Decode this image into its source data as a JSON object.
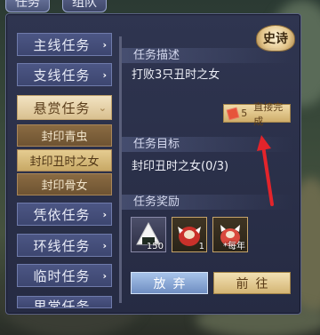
{
  "top_tabs": [
    "任务",
    "组队"
  ],
  "nav": {
    "items": [
      {
        "label": "主线任务",
        "chevron": "›"
      },
      {
        "label": "支线任务",
        "chevron": "›"
      },
      {
        "label": "悬赏任务",
        "chevron": "⌄",
        "active": true
      },
      {
        "label": "凭依任务",
        "chevron": "›"
      },
      {
        "label": "环线任务",
        "chevron": "›"
      },
      {
        "label": "临时任务",
        "chevron": "›"
      },
      {
        "label": "里常任务",
        "chevron": "›"
      }
    ],
    "subitems": [
      {
        "label": "封印青虫",
        "selected": false
      },
      {
        "label": "封印丑时之女",
        "selected": true
      },
      {
        "label": "封印骨女",
        "selected": false
      }
    ]
  },
  "detail": {
    "desc_title": "任务描述",
    "desc_text": "打败3只丑时之女",
    "goal_title": "任务目标",
    "goal_text": "封印丑时之女(0/3)",
    "reward_title": "任务奖励"
  },
  "shishi_label": "史诗",
  "complete_button": {
    "count": "5",
    "label": "直接完成"
  },
  "rewards": [
    {
      "icon": "rice-ball-icon",
      "qty": "150"
    },
    {
      "icon": "daruma-icon",
      "qty": "1"
    },
    {
      "icon": "gift-icon",
      "qty": "*每年"
    }
  ],
  "actions": {
    "abandon": "放弃",
    "goto": "前往"
  },
  "colors": {
    "panel": "#2f3550",
    "accent_gold": "#d9c08f",
    "arrow_red": "#e3242b"
  }
}
